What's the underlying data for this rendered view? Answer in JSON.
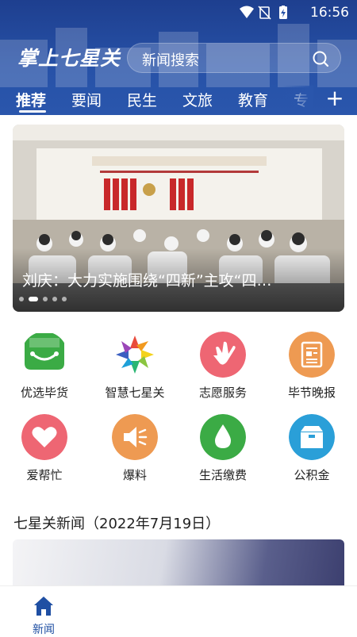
{
  "status": {
    "time": "16:56"
  },
  "header": {
    "logo": "掌上七星关",
    "search_placeholder": "新闻搜索",
    "tabs": [
      "推荐",
      "要闻",
      "民生",
      "文旅",
      "教育",
      "专"
    ]
  },
  "banner": {
    "caption": "刘庆：大力实施围绕“四新”主攻“四…",
    "dots": 5,
    "active_dot": 2
  },
  "grid": [
    {
      "label": "优选毕货",
      "icon": "shopping-bag-icon",
      "color": "#3bab45"
    },
    {
      "label": "智慧七星关",
      "icon": "color-wheel-icon",
      "color": "#e94b6a"
    },
    {
      "label": "志愿服务",
      "icon": "heart-hand-icon",
      "color": "#ee6673"
    },
    {
      "label": "毕节晚报",
      "icon": "newspaper-icon",
      "color": "#ee9a52"
    },
    {
      "label": "爱帮忙",
      "icon": "heart-icon",
      "color": "#ee6673"
    },
    {
      "label": "爆料",
      "icon": "megaphone-icon",
      "color": "#ee9a52"
    },
    {
      "label": "生活缴费",
      "icon": "water-drop-icon",
      "color": "#3bab45"
    },
    {
      "label": "公积金",
      "icon": "box-icon",
      "color": "#2a9fd8"
    }
  ],
  "section": {
    "title": "七星关新闻（2022年7月19日）"
  },
  "bottom_nav": {
    "news_label": "新闻"
  }
}
